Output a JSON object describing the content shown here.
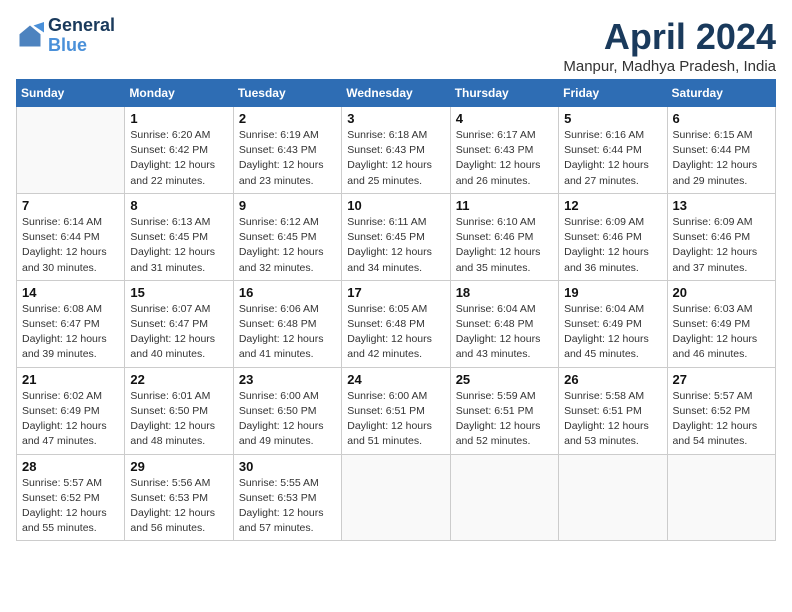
{
  "logo": {
    "line1": "General",
    "line2": "Blue"
  },
  "title": "April 2024",
  "subtitle": "Manpur, Madhya Pradesh, India",
  "days_header": [
    "Sunday",
    "Monday",
    "Tuesday",
    "Wednesday",
    "Thursday",
    "Friday",
    "Saturday"
  ],
  "weeks": [
    [
      {
        "day": "",
        "info": ""
      },
      {
        "day": "1",
        "info": "Sunrise: 6:20 AM\nSunset: 6:42 PM\nDaylight: 12 hours\nand 22 minutes."
      },
      {
        "day": "2",
        "info": "Sunrise: 6:19 AM\nSunset: 6:43 PM\nDaylight: 12 hours\nand 23 minutes."
      },
      {
        "day": "3",
        "info": "Sunrise: 6:18 AM\nSunset: 6:43 PM\nDaylight: 12 hours\nand 25 minutes."
      },
      {
        "day": "4",
        "info": "Sunrise: 6:17 AM\nSunset: 6:43 PM\nDaylight: 12 hours\nand 26 minutes."
      },
      {
        "day": "5",
        "info": "Sunrise: 6:16 AM\nSunset: 6:44 PM\nDaylight: 12 hours\nand 27 minutes."
      },
      {
        "day": "6",
        "info": "Sunrise: 6:15 AM\nSunset: 6:44 PM\nDaylight: 12 hours\nand 29 minutes."
      }
    ],
    [
      {
        "day": "7",
        "info": "Sunrise: 6:14 AM\nSunset: 6:44 PM\nDaylight: 12 hours\nand 30 minutes."
      },
      {
        "day": "8",
        "info": "Sunrise: 6:13 AM\nSunset: 6:45 PM\nDaylight: 12 hours\nand 31 minutes."
      },
      {
        "day": "9",
        "info": "Sunrise: 6:12 AM\nSunset: 6:45 PM\nDaylight: 12 hours\nand 32 minutes."
      },
      {
        "day": "10",
        "info": "Sunrise: 6:11 AM\nSunset: 6:45 PM\nDaylight: 12 hours\nand 34 minutes."
      },
      {
        "day": "11",
        "info": "Sunrise: 6:10 AM\nSunset: 6:46 PM\nDaylight: 12 hours\nand 35 minutes."
      },
      {
        "day": "12",
        "info": "Sunrise: 6:09 AM\nSunset: 6:46 PM\nDaylight: 12 hours\nand 36 minutes."
      },
      {
        "day": "13",
        "info": "Sunrise: 6:09 AM\nSunset: 6:46 PM\nDaylight: 12 hours\nand 37 minutes."
      }
    ],
    [
      {
        "day": "14",
        "info": "Sunrise: 6:08 AM\nSunset: 6:47 PM\nDaylight: 12 hours\nand 39 minutes."
      },
      {
        "day": "15",
        "info": "Sunrise: 6:07 AM\nSunset: 6:47 PM\nDaylight: 12 hours\nand 40 minutes."
      },
      {
        "day": "16",
        "info": "Sunrise: 6:06 AM\nSunset: 6:48 PM\nDaylight: 12 hours\nand 41 minutes."
      },
      {
        "day": "17",
        "info": "Sunrise: 6:05 AM\nSunset: 6:48 PM\nDaylight: 12 hours\nand 42 minutes."
      },
      {
        "day": "18",
        "info": "Sunrise: 6:04 AM\nSunset: 6:48 PM\nDaylight: 12 hours\nand 43 minutes."
      },
      {
        "day": "19",
        "info": "Sunrise: 6:04 AM\nSunset: 6:49 PM\nDaylight: 12 hours\nand 45 minutes."
      },
      {
        "day": "20",
        "info": "Sunrise: 6:03 AM\nSunset: 6:49 PM\nDaylight: 12 hours\nand 46 minutes."
      }
    ],
    [
      {
        "day": "21",
        "info": "Sunrise: 6:02 AM\nSunset: 6:49 PM\nDaylight: 12 hours\nand 47 minutes."
      },
      {
        "day": "22",
        "info": "Sunrise: 6:01 AM\nSunset: 6:50 PM\nDaylight: 12 hours\nand 48 minutes."
      },
      {
        "day": "23",
        "info": "Sunrise: 6:00 AM\nSunset: 6:50 PM\nDaylight: 12 hours\nand 49 minutes."
      },
      {
        "day": "24",
        "info": "Sunrise: 6:00 AM\nSunset: 6:51 PM\nDaylight: 12 hours\nand 51 minutes."
      },
      {
        "day": "25",
        "info": "Sunrise: 5:59 AM\nSunset: 6:51 PM\nDaylight: 12 hours\nand 52 minutes."
      },
      {
        "day": "26",
        "info": "Sunrise: 5:58 AM\nSunset: 6:51 PM\nDaylight: 12 hours\nand 53 minutes."
      },
      {
        "day": "27",
        "info": "Sunrise: 5:57 AM\nSunset: 6:52 PM\nDaylight: 12 hours\nand 54 minutes."
      }
    ],
    [
      {
        "day": "28",
        "info": "Sunrise: 5:57 AM\nSunset: 6:52 PM\nDaylight: 12 hours\nand 55 minutes."
      },
      {
        "day": "29",
        "info": "Sunrise: 5:56 AM\nSunset: 6:53 PM\nDaylight: 12 hours\nand 56 minutes."
      },
      {
        "day": "30",
        "info": "Sunrise: 5:55 AM\nSunset: 6:53 PM\nDaylight: 12 hours\nand 57 minutes."
      },
      {
        "day": "",
        "info": ""
      },
      {
        "day": "",
        "info": ""
      },
      {
        "day": "",
        "info": ""
      },
      {
        "day": "",
        "info": ""
      }
    ]
  ]
}
